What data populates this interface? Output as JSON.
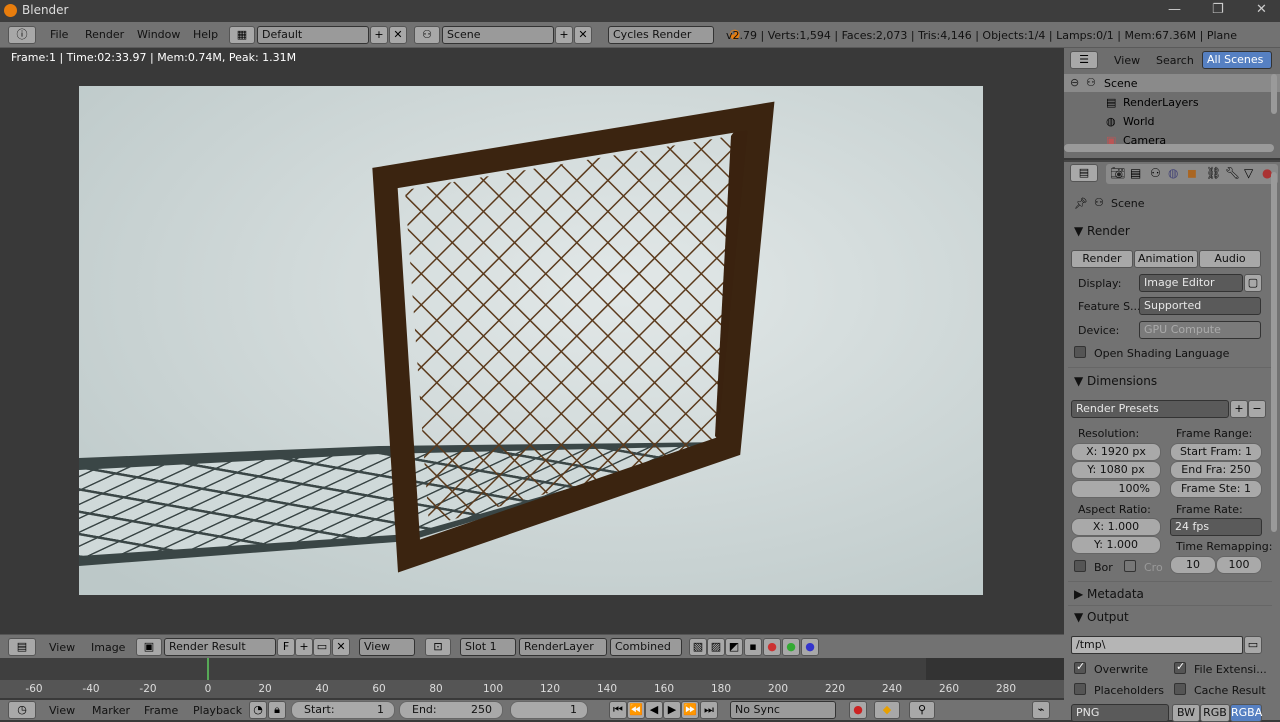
{
  "window": {
    "title": "Blender",
    "min": "—",
    "max": "❐",
    "close": "✕"
  },
  "menubar": {
    "file": "File",
    "render": "Render",
    "window": "Window",
    "help": "Help",
    "layout": "Default",
    "scene": "Scene",
    "engine": "Cycles Render",
    "plus": "+",
    "x": "✕"
  },
  "info": "v2.79 | Verts:1,594 | Faces:2,073 | Tris:4,146 | Objects:1/4 | Lamps:0/1 | Mem:67.36M | Plane",
  "viewport": {
    "status": "Frame:1 | Time:02:33.97 | Mem:0.74M, Peak: 1.31M"
  },
  "image_header": {
    "view": "View",
    "image": "Image",
    "image_name": "Render Result",
    "f": "F",
    "view_menu": "View",
    "slot": "Slot 1",
    "layer": "RenderLayer",
    "pass": "Combined"
  },
  "timeline": {
    "ticks": [
      "-60",
      "-40",
      "-20",
      "0",
      "20",
      "40",
      "60",
      "80",
      "100",
      "120",
      "140",
      "160",
      "180",
      "200",
      "220",
      "240",
      "260",
      "280"
    ]
  },
  "time_header": {
    "view": "View",
    "marker": "Marker",
    "frame": "Frame",
    "playback": "Playback",
    "start_label": "Start:",
    "start": "1",
    "end_label": "End:",
    "end": "250",
    "current": "1",
    "sync": "No Sync"
  },
  "outliner": {
    "view": "View",
    "search": "Search",
    "all_scenes": "All Scenes",
    "items": [
      "Scene",
      "RenderLayers",
      "World",
      "Camera"
    ]
  },
  "props": {
    "context": "Scene",
    "render_panel": "Render",
    "render_btn": "Render",
    "animation_btn": "Animation",
    "audio_btn": "Audio",
    "display_label": "Display:",
    "display": "Image Editor",
    "feature_label": "Feature S...",
    "feature": "Supported",
    "device_label": "Device:",
    "device": "GPU Compute",
    "osl": "Open Shading Language",
    "dimensions_panel": "Dimensions",
    "presets": "Render Presets",
    "resolution_label": "Resolution:",
    "res_x": "X:   1920 px",
    "res_y": "Y:   1080 px",
    "res_pct": "100%",
    "frame_range_label": "Frame Range:",
    "start_frame": "Start Fram: 1",
    "end_frame": "End Fra: 250",
    "frame_step": "Frame Ste: 1",
    "aspect_label": "Aspect Ratio:",
    "aspect_x": "X:        1.000",
    "aspect_y": "Y:        1.000",
    "frame_rate_label": "Frame Rate:",
    "fps": "24 fps",
    "time_remap_label": "Time Remapping:",
    "remap_old": "10",
    "remap_new": "100",
    "border": "Bor",
    "crop": "Cro",
    "metadata_panel": "Metadata",
    "output_panel": "Output",
    "path": "/tmp\\",
    "overwrite": "Overwrite",
    "file_ext": "File Extensi...",
    "placeholders": "Placeholders",
    "cache": "Cache Result",
    "format": "PNG",
    "bw": "BW",
    "rgb": "RGB",
    "rgba": "RGBA"
  }
}
